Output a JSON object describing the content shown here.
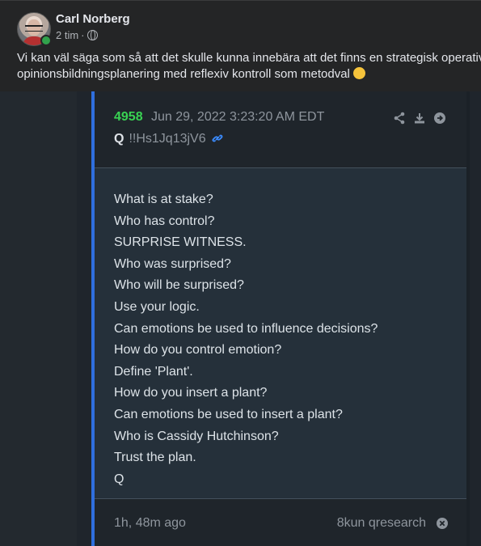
{
  "post": {
    "author": "Carl Norberg",
    "time": "2 tim",
    "separator": "·",
    "text_line1": "Vi kan väl säga som så att det skulle kunna innebära att det finns en strategisk operativ",
    "text_line2": "opinionsbildningsplanering med reflexiv kontroll som metodval",
    "emoji": "winking-face"
  },
  "screenshot": {
    "post_number": "4958",
    "date": "Jun 29, 2022 3:23:20 AM EDT",
    "author_initial": "Q",
    "tripcode": "!!Hs1Jq13jV6",
    "message_lines": [
      "What is at stake?",
      "Who has control?",
      "SURPRISE WITNESS.",
      "Who was surprised?",
      "Who will be surprised?",
      "Use your logic.",
      "Can emotions be used to influence decisions?",
      "How do you control emotion?",
      "Define 'Plant'.",
      "How do you insert a plant?",
      "Can emotions be used to insert a plant?",
      "Who is Cassidy Hutchinson?",
      "Trust the plan.",
      "Q"
    ],
    "ago": "1h, 48m ago",
    "source": "8kun qresearch"
  },
  "colors": {
    "accent_blue": "#2f6fde",
    "post_number_green": "#39d353",
    "online_green": "#31a24c"
  }
}
